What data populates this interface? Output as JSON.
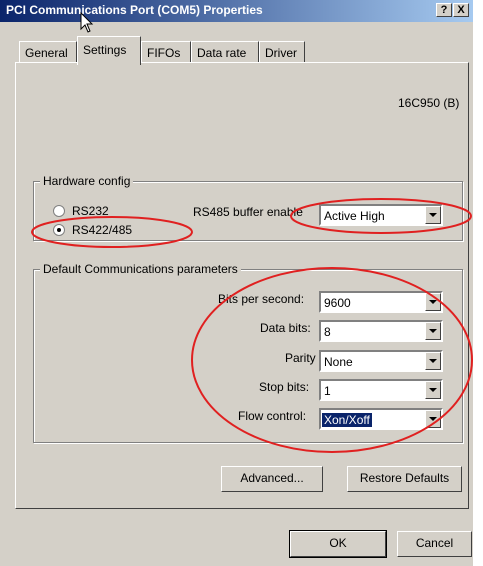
{
  "window": {
    "title": "PCI Communications Port (COM5) Properties",
    "help_label": "?",
    "close_label": "X"
  },
  "tabs": [
    "General",
    "Settings",
    "FIFOs",
    "Data rate",
    "Driver"
  ],
  "chip": "16C950 (B)",
  "hardware": {
    "group_label": "Hardware config",
    "options": [
      "RS232",
      "RS422/485"
    ],
    "selected_index": 1,
    "buffer_label": "RS485 buffer enable",
    "buffer_value": "Active High"
  },
  "comm": {
    "group_label": "Default Communications parameters",
    "fields": [
      {
        "label": "Bits per second:",
        "value": "9600"
      },
      {
        "label": "Data bits:",
        "value": "8"
      },
      {
        "label": "Parity",
        "value": "None"
      },
      {
        "label": "Stop bits:",
        "value": "1"
      },
      {
        "label": "Flow control:",
        "value": "Xon/Xoff"
      }
    ]
  },
  "buttons": {
    "advanced": "Advanced...",
    "restore": "Restore Defaults",
    "ok": "OK",
    "cancel": "Cancel"
  },
  "annotation_color": "#e02020"
}
